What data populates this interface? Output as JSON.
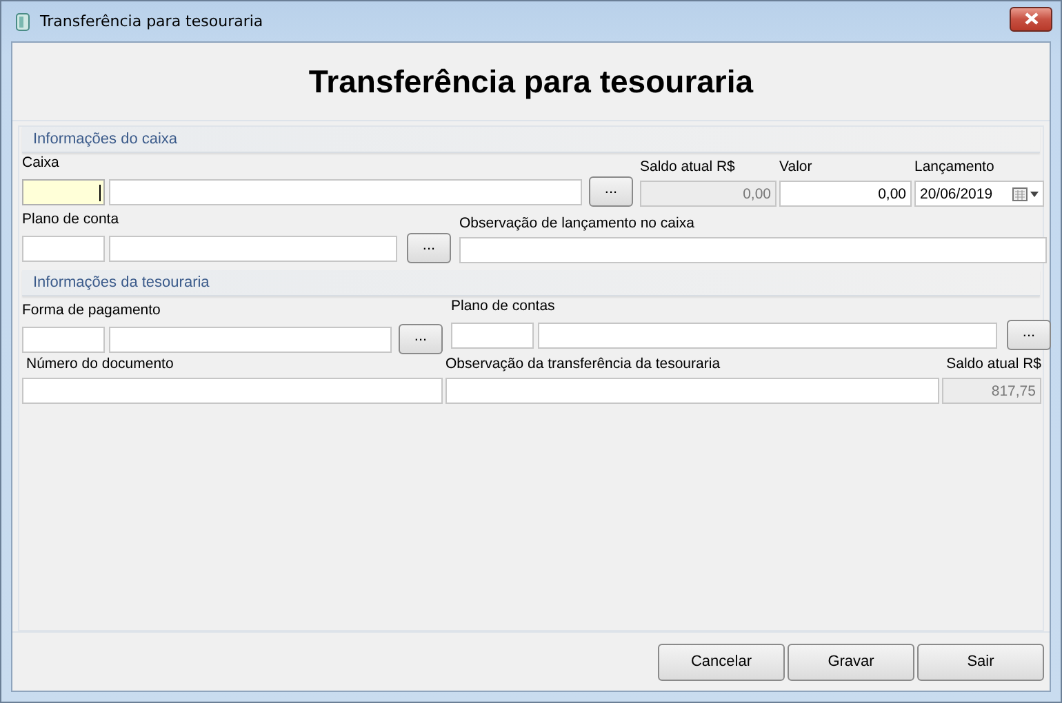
{
  "window": {
    "title": "Transferência para tesouraria"
  },
  "heading": "Transferência para tesouraria",
  "caixa_section": {
    "title": "Informações do caixa",
    "caixa": {
      "label": "Caixa",
      "code": {
        "focused": true
      },
      "lookup": "..."
    },
    "saldo": {
      "label": "Saldo atual R$",
      "value": "0,00",
      "disabled": true
    },
    "valor": {
      "label": "Valor",
      "value": "0,00"
    },
    "lancamento": {
      "label": "Lançamento",
      "value": "20/06/2019"
    },
    "plano": {
      "label": "Plano de conta",
      "lookup": "..."
    },
    "observacao": {
      "label": "Observação de lançamento no caixa"
    }
  },
  "tesouraria_section": {
    "title": "Informações da tesouraria",
    "forma": {
      "label": "Forma de pagamento",
      "lookup": "..."
    },
    "plano": {
      "label": "Plano de contas",
      "lookup": "..."
    },
    "documento": {
      "label": "Número do documento"
    },
    "observacao": {
      "label": "Observação da transferência da tesouraria"
    },
    "saldo": {
      "label": "Saldo atual R$",
      "value": "817,75",
      "disabled": true
    }
  },
  "buttons": [
    "Cancelar",
    "Gravar",
    "Sair"
  ]
}
